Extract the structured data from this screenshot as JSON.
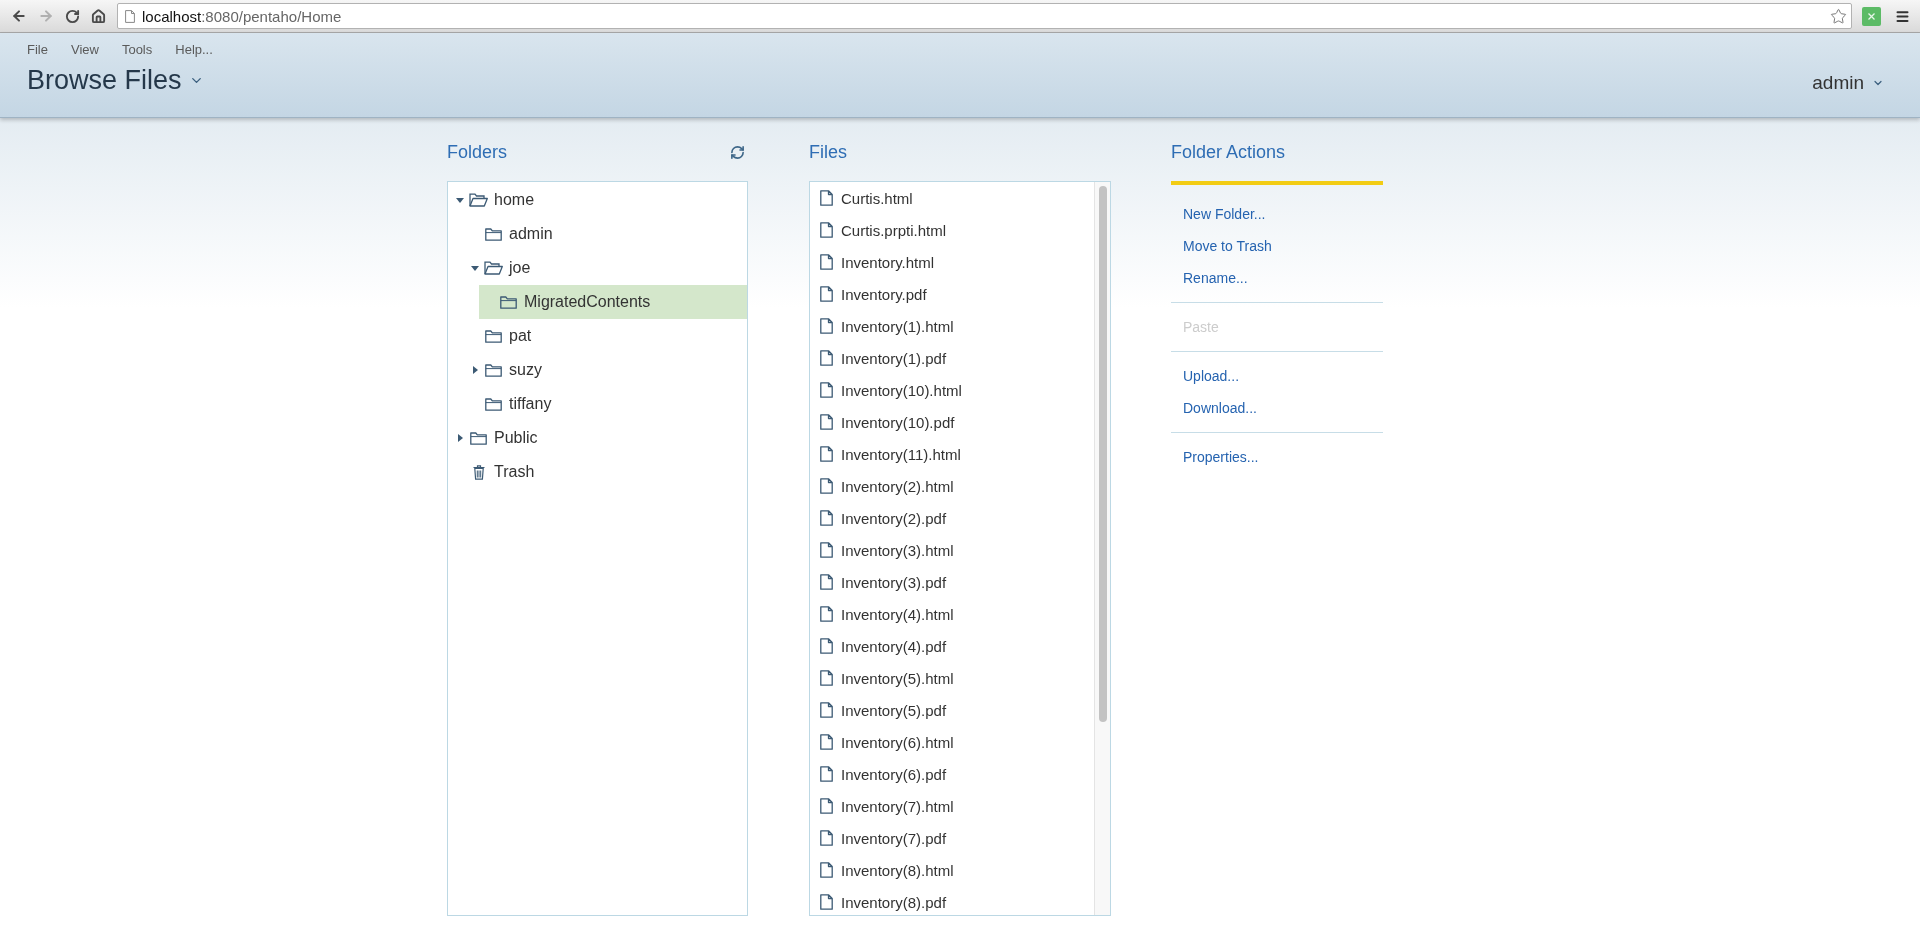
{
  "browser": {
    "url_host": "localhost",
    "url_path": ":8080/pentaho/Home"
  },
  "menu": [
    "File",
    "View",
    "Tools",
    "Help..."
  ],
  "perspective": "Browse Files",
  "user": "admin",
  "folders": {
    "title": "Folders",
    "tree": [
      {
        "label": "home",
        "kind": "folder",
        "expanded": true,
        "selected": false,
        "children": [
          {
            "label": "admin",
            "kind": "folder",
            "selected": false
          },
          {
            "label": "joe",
            "kind": "folder",
            "expanded": true,
            "selected": false,
            "children": [
              {
                "label": "MigratedContents",
                "kind": "folder",
                "selected": true
              }
            ]
          },
          {
            "label": "pat",
            "kind": "folder",
            "selected": false
          },
          {
            "label": "suzy",
            "kind": "folder",
            "expanded": false,
            "selected": false
          },
          {
            "label": "tiffany",
            "kind": "folder",
            "selected": false
          }
        ]
      },
      {
        "label": "Public",
        "kind": "folder",
        "expanded": false,
        "selected": false
      },
      {
        "label": "Trash",
        "kind": "trash",
        "selected": false
      }
    ]
  },
  "files": {
    "title": "Files",
    "items": [
      {
        "name": "Curtis.html",
        "selected": false
      },
      {
        "name": "Curtis.prpti.html",
        "selected": false
      },
      {
        "name": "Inventory.html",
        "selected": false
      },
      {
        "name": "Inventory.pdf",
        "selected": false
      },
      {
        "name": "Inventory(1).html",
        "selected": false
      },
      {
        "name": "Inventory(1).pdf",
        "selected": false
      },
      {
        "name": "Inventory(10).html",
        "selected": false
      },
      {
        "name": "Inventory(10).pdf",
        "selected": false
      },
      {
        "name": "Inventory(11).html",
        "selected": false
      },
      {
        "name": "Inventory(2).html",
        "selected": false
      },
      {
        "name": "Inventory(2).pdf",
        "selected": false
      },
      {
        "name": "Inventory(3).html",
        "selected": false
      },
      {
        "name": "Inventory(3).pdf",
        "selected": false
      },
      {
        "name": "Inventory(4).html",
        "selected": false
      },
      {
        "name": "Inventory(4).pdf",
        "selected": false
      },
      {
        "name": "Inventory(5).html",
        "selected": false
      },
      {
        "name": "Inventory(5).pdf",
        "selected": false
      },
      {
        "name": "Inventory(6).html",
        "selected": false
      },
      {
        "name": "Inventory(6).pdf",
        "selected": false
      },
      {
        "name": "Inventory(7).html",
        "selected": false
      },
      {
        "name": "Inventory(7).pdf",
        "selected": false
      },
      {
        "name": "Inventory(8).html",
        "selected": false
      },
      {
        "name": "Inventory(8).pdf",
        "selected": false
      }
    ]
  },
  "actions": {
    "title": "Folder Actions",
    "groups": [
      {
        "items": [
          {
            "label": "New Folder...",
            "disabled": false
          },
          {
            "label": "Move to Trash",
            "disabled": false
          },
          {
            "label": "Rename...",
            "disabled": false
          }
        ]
      },
      {
        "items": [
          {
            "label": "Paste",
            "disabled": true
          }
        ]
      },
      {
        "items": [
          {
            "label": "Upload...",
            "disabled": false
          },
          {
            "label": "Download...",
            "disabled": false
          }
        ]
      },
      {
        "items": [
          {
            "label": "Properties...",
            "disabled": false
          }
        ]
      }
    ]
  }
}
